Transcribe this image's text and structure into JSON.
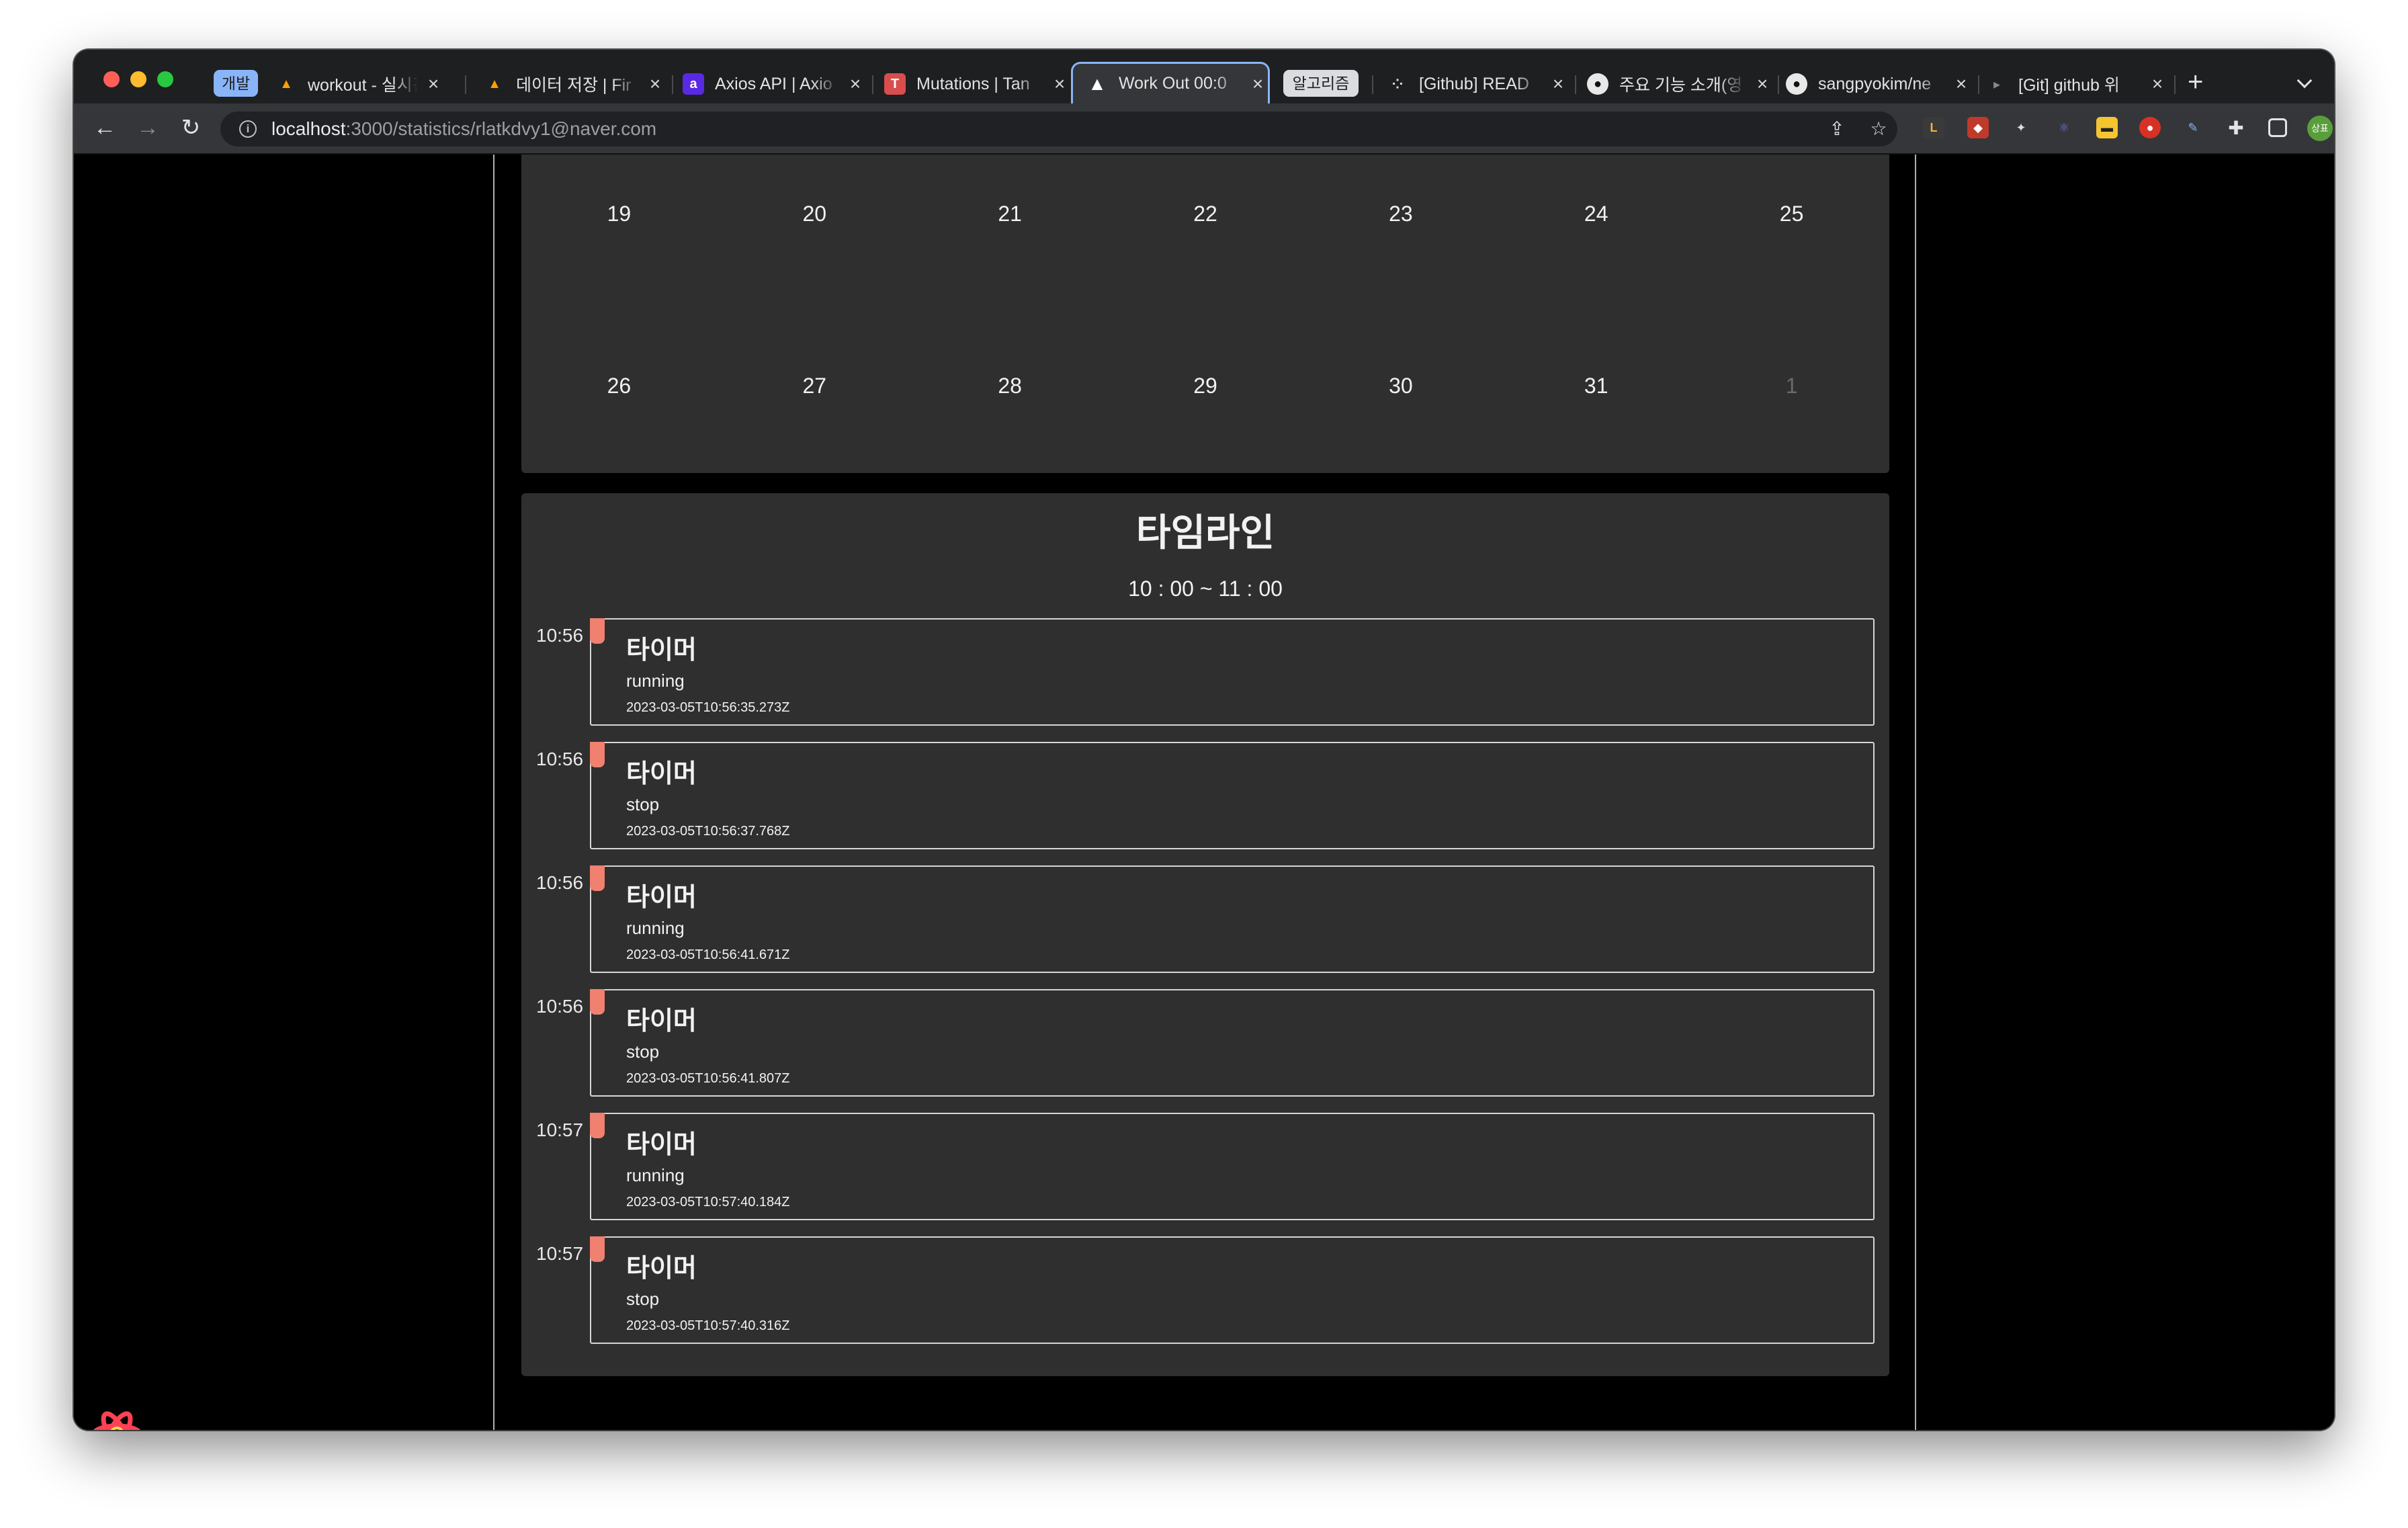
{
  "browser": {
    "tab_group_label": "개발",
    "tab_group_label2": "알고리즘",
    "tabs": [
      {
        "title": "workout - 실시간",
        "favicon": "firebase-icon",
        "active": false
      },
      {
        "title": "데이터 저장 | Fir",
        "favicon": "firebase-icon",
        "active": false
      },
      {
        "title": "Axios API | Axio",
        "favicon": "axios-icon",
        "active": false
      },
      {
        "title": "Mutations | Tan",
        "favicon": "tanstack-icon",
        "active": false
      },
      {
        "title": "Work Out 00:0",
        "favicon": "vercel-icon",
        "active": true
      },
      {
        "title": "[Github] READ",
        "favicon": "github-icon",
        "active": false
      },
      {
        "title": "주요 기능 소개(영",
        "favicon": "github-icon",
        "active": false
      },
      {
        "title": "sangpyokim/ne",
        "favicon": "github-icon",
        "active": false
      },
      {
        "title": "[Git] github 위",
        "favicon": "page-icon",
        "active": false
      }
    ],
    "new_tab_label": "+",
    "url_host": "localhost",
    "url_path": ":3000/statistics/rlatkdvy1@naver.com",
    "profile_initials": "상표"
  },
  "calendar": {
    "rows": [
      [
        {
          "day": "19",
          "muted": false
        },
        {
          "day": "20",
          "muted": false
        },
        {
          "day": "21",
          "muted": false
        },
        {
          "day": "22",
          "muted": false
        },
        {
          "day": "23",
          "muted": false
        },
        {
          "day": "24",
          "muted": false
        },
        {
          "day": "25",
          "muted": false
        }
      ],
      [
        {
          "day": "26",
          "muted": false
        },
        {
          "day": "27",
          "muted": false
        },
        {
          "day": "28",
          "muted": false
        },
        {
          "day": "29",
          "muted": false
        },
        {
          "day": "30",
          "muted": false
        },
        {
          "day": "31",
          "muted": false
        },
        {
          "day": "1",
          "muted": true
        }
      ]
    ]
  },
  "timeline": {
    "title": "타임라인",
    "range": "10 : 00 ~ 11 : 00",
    "entries": [
      {
        "time": "10:56",
        "title": "타이머",
        "status": "running",
        "timestamp": "2023-03-05T10:56:35.273Z"
      },
      {
        "time": "10:56",
        "title": "타이머",
        "status": "stop",
        "timestamp": "2023-03-05T10:56:37.768Z"
      },
      {
        "time": "10:56",
        "title": "타이머",
        "status": "running",
        "timestamp": "2023-03-05T10:56:41.671Z"
      },
      {
        "time": "10:56",
        "title": "타이머",
        "status": "stop",
        "timestamp": "2023-03-05T10:56:41.807Z"
      },
      {
        "time": "10:57",
        "title": "타이머",
        "status": "running",
        "timestamp": "2023-03-05T10:57:40.184Z"
      },
      {
        "time": "10:57",
        "title": "타이머",
        "status": "stop",
        "timestamp": "2023-03-05T10:57:40.316Z"
      }
    ]
  },
  "colors": {
    "marker": "#f08070",
    "panel": "#2f2f2f",
    "active_tab_outline": "#8ab4f8"
  }
}
